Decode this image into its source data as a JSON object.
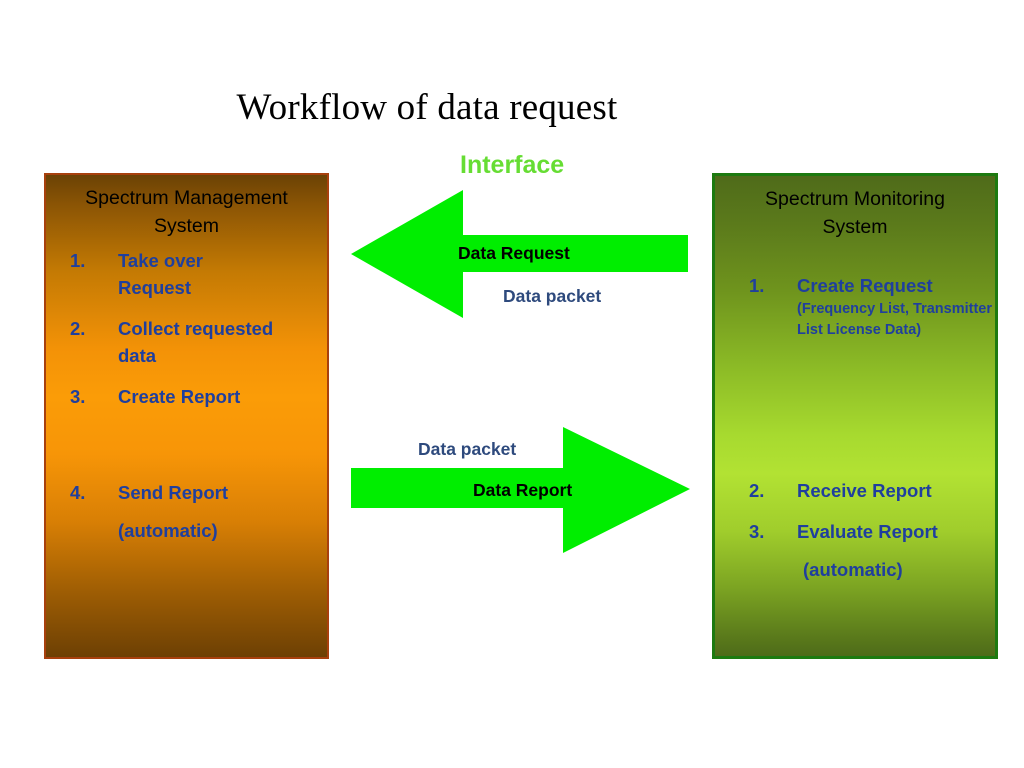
{
  "title": "Workflow of data request",
  "interface_label": "Interface",
  "colors": {
    "arrow": "#00ee00",
    "interface_text": "#66dd33",
    "list_text": "#1f3f9e",
    "packet_text": "#2e4a7d",
    "left_box_border": "#a8400d",
    "right_box_border": "#1d7a10"
  },
  "left_box": {
    "header_line1": "Spectrum Management",
    "header_line2": "System",
    "items": [
      {
        "num": "1.",
        "text": "Take over",
        "text2": "Request"
      },
      {
        "num": "2.",
        "text": "Collect requested",
        "text2": "data"
      },
      {
        "num": "3.",
        "text": "Create Report"
      },
      {
        "num": "4.",
        "text": "Send Report"
      }
    ],
    "note": "(automatic)"
  },
  "right_box": {
    "header_line1": "Spectrum Monitoring",
    "header_line2": "System",
    "items": [
      {
        "num": "1.",
        "text": "Create Request",
        "sub": "(Frequency List, Transmitter List License Data)"
      },
      {
        "num": "2.",
        "text": "Receive Report"
      },
      {
        "num": "3.",
        "text": "Evaluate Report"
      }
    ],
    "note": "(automatic)"
  },
  "arrows": {
    "top": {
      "direction": "left",
      "label_on_arrow": "Data Request",
      "label_below": "Data packet"
    },
    "bottom": {
      "direction": "right",
      "label_above": "Data packet",
      "label_on_arrow": "Data Report"
    }
  }
}
